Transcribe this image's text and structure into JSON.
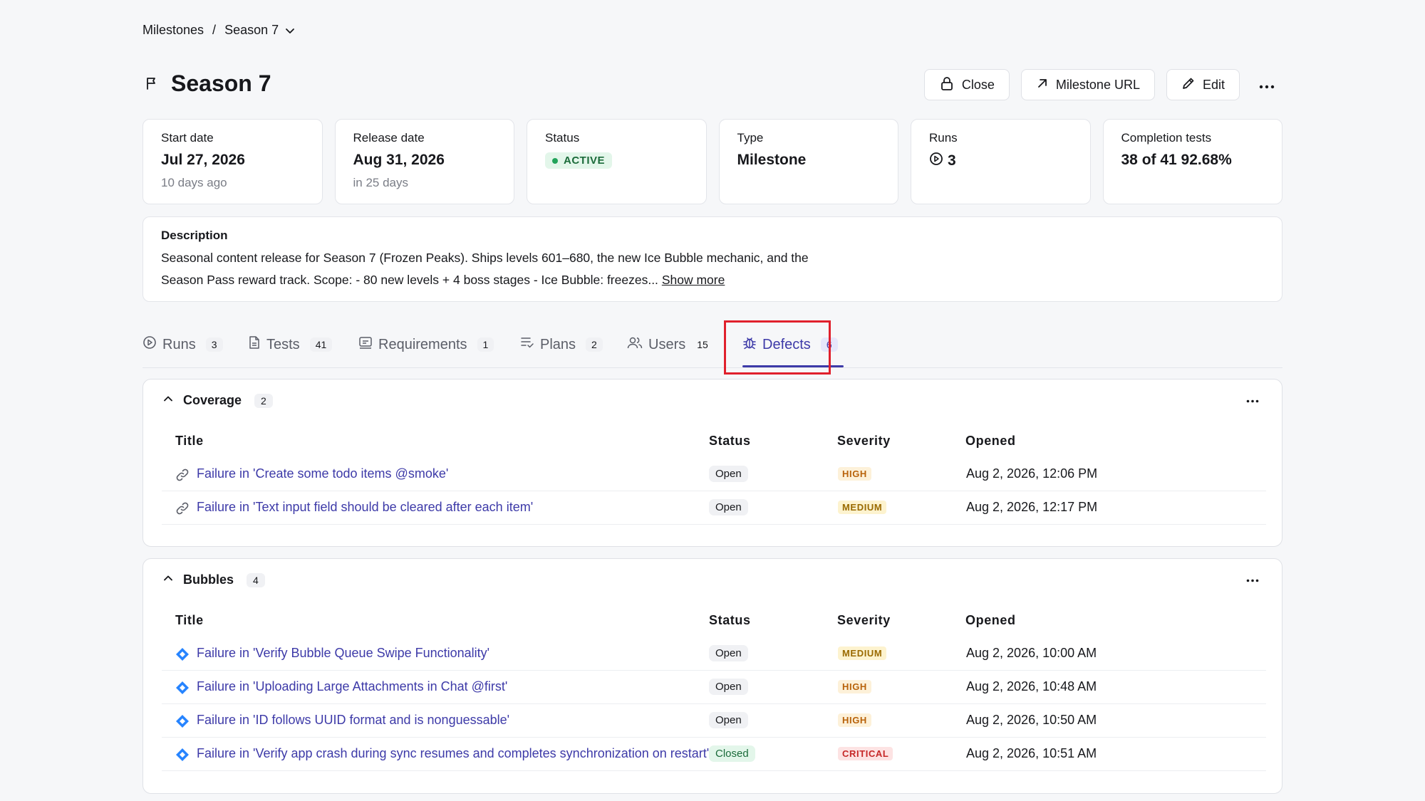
{
  "breadcrumb": {
    "root": "Milestones",
    "separator": "/",
    "current": "Season 7"
  },
  "header": {
    "title": "Season 7",
    "actions": {
      "close": "Close",
      "url": "Milestone URL",
      "edit": "Edit"
    }
  },
  "cards": {
    "start": {
      "label": "Start date",
      "value": "Jul 27, 2026",
      "sub": "10 days ago"
    },
    "release": {
      "label": "Release date",
      "value": "Aug 31, 2026",
      "sub": "in 25 days"
    },
    "status": {
      "label": "Status",
      "value": "ACTIVE"
    },
    "type": {
      "label": "Type",
      "value": "Milestone"
    },
    "runs": {
      "label": "Runs",
      "value": "3"
    },
    "completion": {
      "label": "Completion tests",
      "value": "38 of 41 92.68%"
    }
  },
  "description": {
    "label": "Description",
    "text": "Seasonal content release for Season 7 (Frozen Peaks). Ships levels 601–680, the new Ice Bubble mechanic, and the Season Pass reward track. Scope: - 80 new levels + 4 boss stages - Ice Bubble: freezes...",
    "more": "Show more"
  },
  "tabs": [
    {
      "label": "Runs",
      "count": "3"
    },
    {
      "label": "Tests",
      "count": "41"
    },
    {
      "label": "Requirements",
      "count": "1"
    },
    {
      "label": "Plans",
      "count": "2"
    },
    {
      "label": "Users",
      "count": "15"
    },
    {
      "label": "Defects",
      "count": "6"
    }
  ],
  "columns": {
    "title": "Title",
    "status": "Status",
    "severity": "Severity",
    "opened": "Opened"
  },
  "groups": [
    {
      "name": "Coverage",
      "count": "2",
      "rows": [
        {
          "title": "Failure in 'Create some todo items @smoke'",
          "status": "Open",
          "severity": "HIGH",
          "opened": "Aug 2, 2026, 12:06 PM"
        },
        {
          "title": "Failure in 'Text input field should be cleared after each item'",
          "status": "Open",
          "severity": "MEDIUM",
          "opened": "Aug 2, 2026, 12:17 PM"
        }
      ]
    },
    {
      "name": "Bubbles",
      "count": "4",
      "rows": [
        {
          "title": "Failure in 'Verify Bubble Queue Swipe Functionality'",
          "status": "Open",
          "severity": "MEDIUM",
          "opened": "Aug 2, 2026, 10:00 AM"
        },
        {
          "title": "Failure in 'Uploading Large Attachments in Chat @first'",
          "status": "Open",
          "severity": "HIGH",
          "opened": "Aug 2, 2026, 10:48 AM"
        },
        {
          "title": "Failure in 'ID follows UUID format and is nonguessable'",
          "status": "Open",
          "severity": "HIGH",
          "opened": "Aug 2, 2026, 10:50 AM"
        },
        {
          "title": "Failure in 'Verify app crash during sync resumes and completes synchronization on restart'",
          "status": "Closed",
          "severity": "CRITICAL",
          "opened": "Aug 2, 2026, 10:51 AM"
        }
      ]
    }
  ],
  "colors": {
    "accent": "#3d3aa8",
    "active_green": "#22a35a",
    "highlight": "#e0202c",
    "jira_blue": "#2684ff"
  },
  "icons": {
    "coverage_row": "link-icon",
    "bubbles_row": "jira-diamond-icon"
  }
}
